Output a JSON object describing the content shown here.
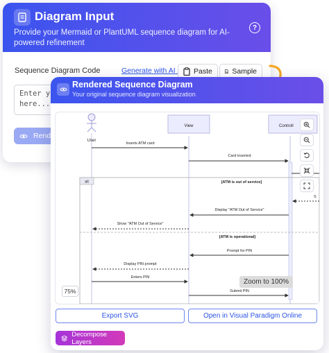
{
  "input_panel": {
    "title": "Diagram Input",
    "subtitle": "Provide your Mermaid or PlantUML sequence diagram for AI-powered refinement",
    "code_label": "Sequence Diagram Code",
    "generate_link": "Generate with AI",
    "paste_label": "Paste",
    "sample_label": "Sample",
    "placeholder": "Enter your\nhere...",
    "render_label": "Rende"
  },
  "output_panel": {
    "title": "Rendered Sequence Diagram",
    "subtitle": "Your original sequence diagram visualization",
    "zoom_tooltip": "Zoom to 100%",
    "zoom_level": "75%",
    "export_label": "Export SVG",
    "visual_paradigm_label": "Open in Visual Paradigm Online",
    "decompose_label": "Decompose Layers"
  },
  "diagram": {
    "participants": [
      "User",
      "View",
      "Controll"
    ],
    "alt_keyword": "alt",
    "guard_1": "[ATM is out of service]",
    "guard_2": "[ATM is operational]",
    "messages": [
      "Inserts ATM card",
      "Card inserted",
      "Display \"ATM Out of Service\"",
      "Show \"ATM Out of Service\"",
      "Prompt for PIN",
      "Display PIN prompt",
      "Enters PIN",
      "Submit PIN"
    ],
    "cut_label": "S"
  },
  "colors": {
    "header_start": "#3b54ee",
    "header_end": "#6a4ee9",
    "link": "#2d55e6",
    "decompose_start": "#a634d9",
    "decompose_end": "#d23ab9",
    "arrow": "#f5a623"
  }
}
